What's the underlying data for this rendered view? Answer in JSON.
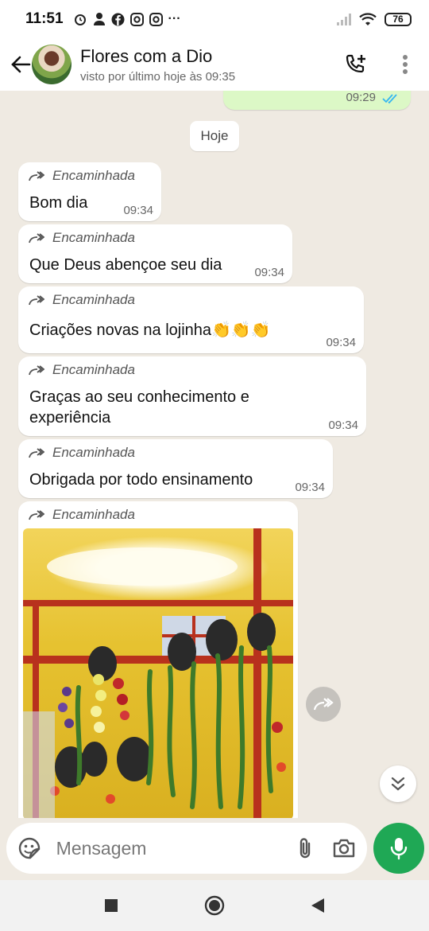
{
  "status_bar": {
    "time": "11:51",
    "left_icons": [
      "alarm-icon",
      "person-icon",
      "facebook-icon",
      "instagram-icon",
      "instagram-icon"
    ],
    "more": "···",
    "battery": "76"
  },
  "header": {
    "contact_name": "Flores com a Dio",
    "last_seen": "visto por último hoje às 09:35"
  },
  "chat": {
    "previous_outgoing_time": "09:29",
    "date_divider": "Hoje",
    "forwarded_label": "Encaminhada",
    "messages": [
      {
        "text": "Bom dia",
        "time": "09:34"
      },
      {
        "text": "Que Deus abençoe seu dia",
        "time": "09:34"
      },
      {
        "text": "Criações novas na lojinha👏👏👏",
        "time": "09:34"
      },
      {
        "text": "Graças ao seu conhecimento e\nexperiência",
        "time": "09:34"
      },
      {
        "text": "Obrigada por todo ensinamento",
        "time": "09:34"
      }
    ]
  },
  "composer": {
    "placeholder": "Mensagem"
  },
  "colors": {
    "accent_green": "#1fa855",
    "chat_background": "#efeae2",
    "outgoing_bubble": "#dcf8c6",
    "read_ticks": "#34b7f1"
  }
}
